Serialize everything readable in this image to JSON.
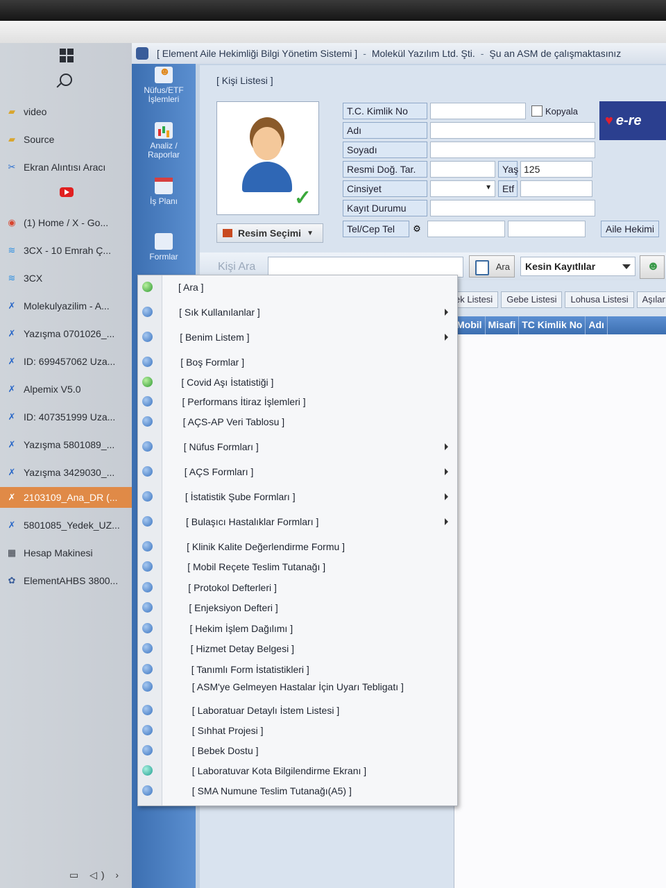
{
  "start_menu": {
    "items": [
      {
        "label": "video",
        "icon": "folder-icon"
      },
      {
        "label": "Source",
        "icon": "folder-icon"
      },
      {
        "label": "Ekran Alıntısı Aracı",
        "icon": "scissors-icon"
      },
      {
        "label": "(1) Home / X - Go...",
        "icon": "chrome-icon"
      },
      {
        "label": "3CX - 10 Emrah Ç...",
        "icon": "wifi-icon"
      },
      {
        "label": "3CX",
        "icon": "wifi-icon"
      },
      {
        "label": "Molekulyazilim - A...",
        "icon": "anydesk-icon"
      },
      {
        "label": "Yazışma 0701026_...",
        "icon": "anydesk-icon"
      },
      {
        "label": "ID: 699457062 Uza...",
        "icon": "anydesk-icon"
      },
      {
        "label": "Alpemix V5.0",
        "icon": "anydesk-icon"
      },
      {
        "label": "ID: 407351999 Uza...",
        "icon": "anydesk-icon"
      },
      {
        "label": "Yazışma 5801089_...",
        "icon": "anydesk-icon"
      },
      {
        "label": "Yazışma 3429030_...",
        "icon": "anydesk-icon"
      },
      {
        "label": "2103109_Ana_DR (...",
        "icon": "anydesk-icon",
        "selected": true
      },
      {
        "label": "5801085_Yedek_UZ...",
        "icon": "anydesk-icon"
      },
      {
        "label": "Hesap Makinesi",
        "icon": "calculator-icon"
      },
      {
        "label": "ElementAHBS 3800...",
        "icon": "app-icon"
      }
    ]
  },
  "app": {
    "title": "[ Element Aile Hekimliği Bilgi Yönetim Sistemi ]",
    "title_company": "Molekül Yazılım Ltd. Şti.",
    "title_status": "Şu an ASM de çalışmaktasınız",
    "nav": {
      "nufus": "Nüfus/ETF İşlemleri",
      "analiz": "Analiz / Raporlar",
      "is_plani": "İş Planı",
      "formlar": "Formlar"
    },
    "panel_title": "[ Kişi Listesi ]",
    "photo_button": "Resim Seçimi",
    "brand": "e-re",
    "form": {
      "tc_label": "T.C. Kimlik No",
      "kopyala": "Kopyala",
      "adi_label": "Adı",
      "soyadi_label": "Soyadı",
      "dog_tar_label": "Resmi Doğ. Tar.",
      "yas_label": "Yaş",
      "yas_value": "125",
      "cinsiyet_label": "Cinsiyet",
      "etf_label": "Etf",
      "kayit_label": "Kayıt Durumu",
      "tel_label": "Tel/Cep Tel",
      "aile_hekimi_label": "Aile Hekimi"
    },
    "search": {
      "kisi_ara": "Kişi Ara",
      "ara_button": "Ara",
      "filter_value": "Kesin Kayıtlılar"
    },
    "tabs": [
      "ek Listesi",
      "Gebe Listesi",
      "Lohusa Listesi",
      "Aşılar"
    ],
    "grid_columns": [
      "Mobil",
      "Misafi",
      "TC Kimlik No",
      "Adı"
    ]
  },
  "context_menu": {
    "items": [
      {
        "label": "[ Ara ]",
        "submenu": false,
        "icon": "green"
      },
      {
        "label": "[ Sık Kullanılanlar ]",
        "submenu": true,
        "icon": "blue"
      },
      {
        "label": "[ Benim Listem ]",
        "submenu": true,
        "icon": "blue"
      },
      {
        "label": "[ Boş Formlar ]",
        "submenu": false,
        "icon": "blue"
      },
      {
        "label": "[ Covid Aşı İstatistiği ]",
        "submenu": false,
        "icon": "green"
      },
      {
        "label": "[ Performans İtiraz İşlemleri ]",
        "submenu": false,
        "icon": "blue"
      },
      {
        "label": "[ AÇS-AP Veri Tablosu ]",
        "submenu": false,
        "icon": "blue"
      },
      {
        "label": "[ Nüfus Formları ]",
        "submenu": true,
        "icon": "blue"
      },
      {
        "label": "[ AÇS Formları ]",
        "submenu": true,
        "icon": "blue"
      },
      {
        "label": "[ İstatistik Şube Formları ]",
        "submenu": true,
        "icon": "blue"
      },
      {
        "label": "[ Bulaşıcı Hastalıklar Formları ]",
        "submenu": true,
        "icon": "blue"
      },
      {
        "label": "[ Klinik Kalite Değerlendirme Formu ]",
        "submenu": false,
        "icon": "blue"
      },
      {
        "label": "[ Mobil Reçete Teslim Tutanağı ]",
        "submenu": false,
        "icon": "blue"
      },
      {
        "label": "[ Protokol Defterleri ]",
        "submenu": false,
        "icon": "blue"
      },
      {
        "label": "[ Enjeksiyon Defteri ]",
        "submenu": false,
        "icon": "blue"
      },
      {
        "label": "[ Hekim İşlem Dağılımı ]",
        "submenu": false,
        "icon": "blue"
      },
      {
        "label": "[ Hizmet Detay Belgesi ]",
        "submenu": false,
        "icon": "blue"
      },
      {
        "label": "[ Tanımlı Form İstatistikleri ]",
        "submenu": false,
        "icon": "blue"
      },
      {
        "label": "[ ASM'ye Gelmeyen Hastalar İçin Uyarı Tebligatı ]",
        "submenu": false,
        "icon": "blue"
      },
      {
        "label": "[ Laboratuar Detaylı İstem Listesi ]",
        "submenu": false,
        "icon": "blue"
      },
      {
        "label": "[ Sıhhat Projesi ]",
        "submenu": false,
        "icon": "blue"
      },
      {
        "label": "[ Bebek Dostu ]",
        "submenu": false,
        "icon": "blue"
      },
      {
        "label": "[ Laboratuvar Kota Bilgilendirme Ekranı ]",
        "submenu": false,
        "icon": "teal"
      },
      {
        "label": "[ SMA Numune Teslim Tutanağı(A5) ]",
        "submenu": false,
        "icon": "blue"
      }
    ]
  }
}
